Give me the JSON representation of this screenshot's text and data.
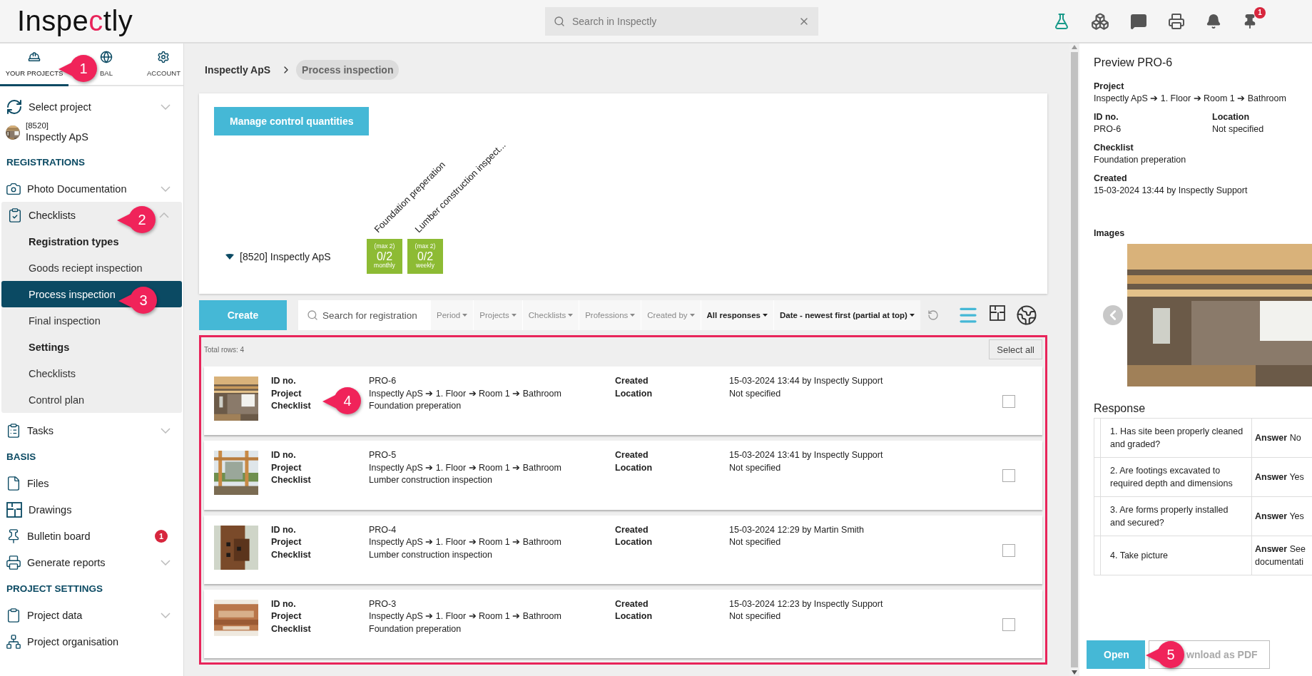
{
  "header": {
    "logo": {
      "before": "Inspe",
      "accent": "c",
      "after": "tly"
    },
    "search": {
      "placeholder": "Search in Inspectly"
    },
    "notification_count": "1"
  },
  "sidebar": {
    "tabs": [
      {
        "label": "YOUR PROJECTS",
        "selected": true
      },
      {
        "label": "BAL",
        "selected": false
      },
      {
        "label": "ACCOUNT",
        "selected": false
      }
    ],
    "project_selector": {
      "label": "Select project",
      "code": "[8520]",
      "name": "Inspectly ApS"
    },
    "groups": [
      {
        "heading": "REGISTRATIONS",
        "items": [
          {
            "label": "Photo Documentation",
            "expanded": false
          },
          {
            "label": "Checklists",
            "expanded": true,
            "children": [
              {
                "kind": "subheading",
                "label": "Registration types",
                "selected": false
              },
              {
                "kind": "link",
                "label": "Goods reciept inspection",
                "selected": false
              },
              {
                "kind": "link",
                "label": "Process inspection",
                "selected": true
              },
              {
                "kind": "link",
                "label": "Final inspection",
                "selected": false
              },
              {
                "kind": "subheading",
                "label": "Settings",
                "selected": false
              },
              {
                "kind": "link",
                "label": "Checklists",
                "selected": false
              },
              {
                "kind": "link",
                "label": "Control plan",
                "selected": false
              }
            ]
          },
          {
            "label": "Tasks",
            "expanded": false
          }
        ]
      },
      {
        "heading": "BASIS",
        "items": [
          {
            "label": "Files"
          },
          {
            "label": "Drawings"
          },
          {
            "label": "Bulletin board",
            "badge": "1"
          },
          {
            "label": "Generate reports",
            "expanded": false
          }
        ]
      },
      {
        "heading": "PROJECT SETTINGS",
        "items": [
          {
            "label": "Project data",
            "expanded": false
          },
          {
            "label": "Project organisation"
          }
        ]
      }
    ]
  },
  "breadcrumb": [
    {
      "label": "Inspectly ApS",
      "selected": false
    },
    {
      "label": "Process inspection",
      "selected": true
    }
  ],
  "control_quantities": {
    "button": "Manage control quantities",
    "project": "[8520] Inspectly ApS",
    "expanded": true,
    "columns": [
      {
        "title": "Foundation preperation",
        "max": "(max 2)",
        "count": "0/2",
        "period": "monthly"
      },
      {
        "title": "Lumber construction inspect...",
        "max": "(max 2)",
        "count": "0/2",
        "period": "weekly"
      }
    ]
  },
  "toolbar": {
    "create": "Create",
    "search": {
      "placeholder": "Search for registration"
    },
    "filters": [
      {
        "label": "Period",
        "active": false
      },
      {
        "label": "Projects",
        "active": false
      },
      {
        "label": "Checklists",
        "active": false
      },
      {
        "label": "Professions",
        "active": false
      },
      {
        "label": "Created by",
        "active": false
      },
      {
        "label": "All responses",
        "active": true
      },
      {
        "label": "Date - newest first (partial at top)",
        "active": true
      }
    ],
    "view_modes": [
      {
        "selected": true
      },
      {
        "selected": false
      },
      {
        "selected": false
      }
    ]
  },
  "list": {
    "total": "Total rows: 4",
    "select_all": "Select all",
    "rows": [
      {
        "fields": [
          {
            "label": "ID no.",
            "value": "PRO-6"
          },
          {
            "label": "Project",
            "value": "Inspectly ApS ➔ 1. Floor ➔ Room 1 ➔ Bathroom"
          },
          {
            "label": "Checklist",
            "value": "Foundation preperation"
          }
        ],
        "meta": [
          {
            "label": "Created",
            "value": "15-03-2024 13:44 by Inspectly Support"
          },
          {
            "label": "Location",
            "value": "Not specified"
          }
        ],
        "checked": false
      },
      {
        "fields": [
          {
            "label": "ID no.",
            "value": "PRO-5"
          },
          {
            "label": "Project",
            "value": "Inspectly ApS ➔ 1. Floor ➔ Room 1 ➔ Bathroom"
          },
          {
            "label": "Checklist",
            "value": "Lumber construction inspection"
          }
        ],
        "meta": [
          {
            "label": "Created",
            "value": "15-03-2024 13:41 by Inspectly Support"
          },
          {
            "label": "Location",
            "value": "Not specified"
          }
        ],
        "checked": false
      },
      {
        "fields": [
          {
            "label": "ID no.",
            "value": "PRO-4"
          },
          {
            "label": "Project",
            "value": "Inspectly ApS ➔ 1. Floor ➔ Room 1 ➔ Bathroom"
          },
          {
            "label": "Checklist",
            "value": "Lumber construction inspection"
          }
        ],
        "meta": [
          {
            "label": "Created",
            "value": "15-03-2024 12:29 by Martin Smith"
          },
          {
            "label": "Location",
            "value": "Not specified"
          }
        ],
        "checked": false
      },
      {
        "fields": [
          {
            "label": "ID no.",
            "value": "PRO-3"
          },
          {
            "label": "Project",
            "value": "Inspectly ApS ➔ 1. Floor ➔ Room 1 ➔ Bathroom"
          },
          {
            "label": "Checklist",
            "value": "Foundation preperation"
          }
        ],
        "meta": [
          {
            "label": "Created",
            "value": "15-03-2024 12:23 by Inspectly Support"
          },
          {
            "label": "Location",
            "value": "Not specified"
          }
        ],
        "checked": false
      }
    ]
  },
  "preview": {
    "title": "Preview PRO-6",
    "project": {
      "label": "Project",
      "value": "Inspectly ApS ➔ 1. Floor ➔ Room 1 ➔ Bathroom"
    },
    "pairs": [
      {
        "label": "ID no.",
        "value": "PRO-6"
      },
      {
        "label": "Location",
        "value": "Not specified"
      }
    ],
    "fields": [
      {
        "label": "Checklist",
        "value": "Foundation preperation"
      },
      {
        "label": "Created",
        "value": "15-03-2024 13:44 by Inspectly Support"
      }
    ],
    "images_label": "Images",
    "response_heading": "Response",
    "responses": [
      {
        "question": "1. Has site been properly cleaned and graded?",
        "answer_label": "Answer",
        "answer": "No"
      },
      {
        "question": "2. Are footings excavated to required depth and dimensions",
        "answer_label": "Answer",
        "answer": "Yes"
      },
      {
        "question": "3. Are forms properly installed and secured?",
        "answer_label": "Answer",
        "answer": "Yes"
      },
      {
        "question": "4. Take picture",
        "answer_label": "Answer",
        "answer": "See documentati"
      }
    ],
    "buttons": [
      {
        "label": "Open",
        "kind": "primary"
      },
      {
        "label": "wnload as PDF",
        "kind": "outline"
      }
    ]
  },
  "callouts": [
    {
      "number": "1"
    },
    {
      "number": "2"
    },
    {
      "number": "3"
    },
    {
      "number": "4"
    },
    {
      "number": "5"
    }
  ]
}
